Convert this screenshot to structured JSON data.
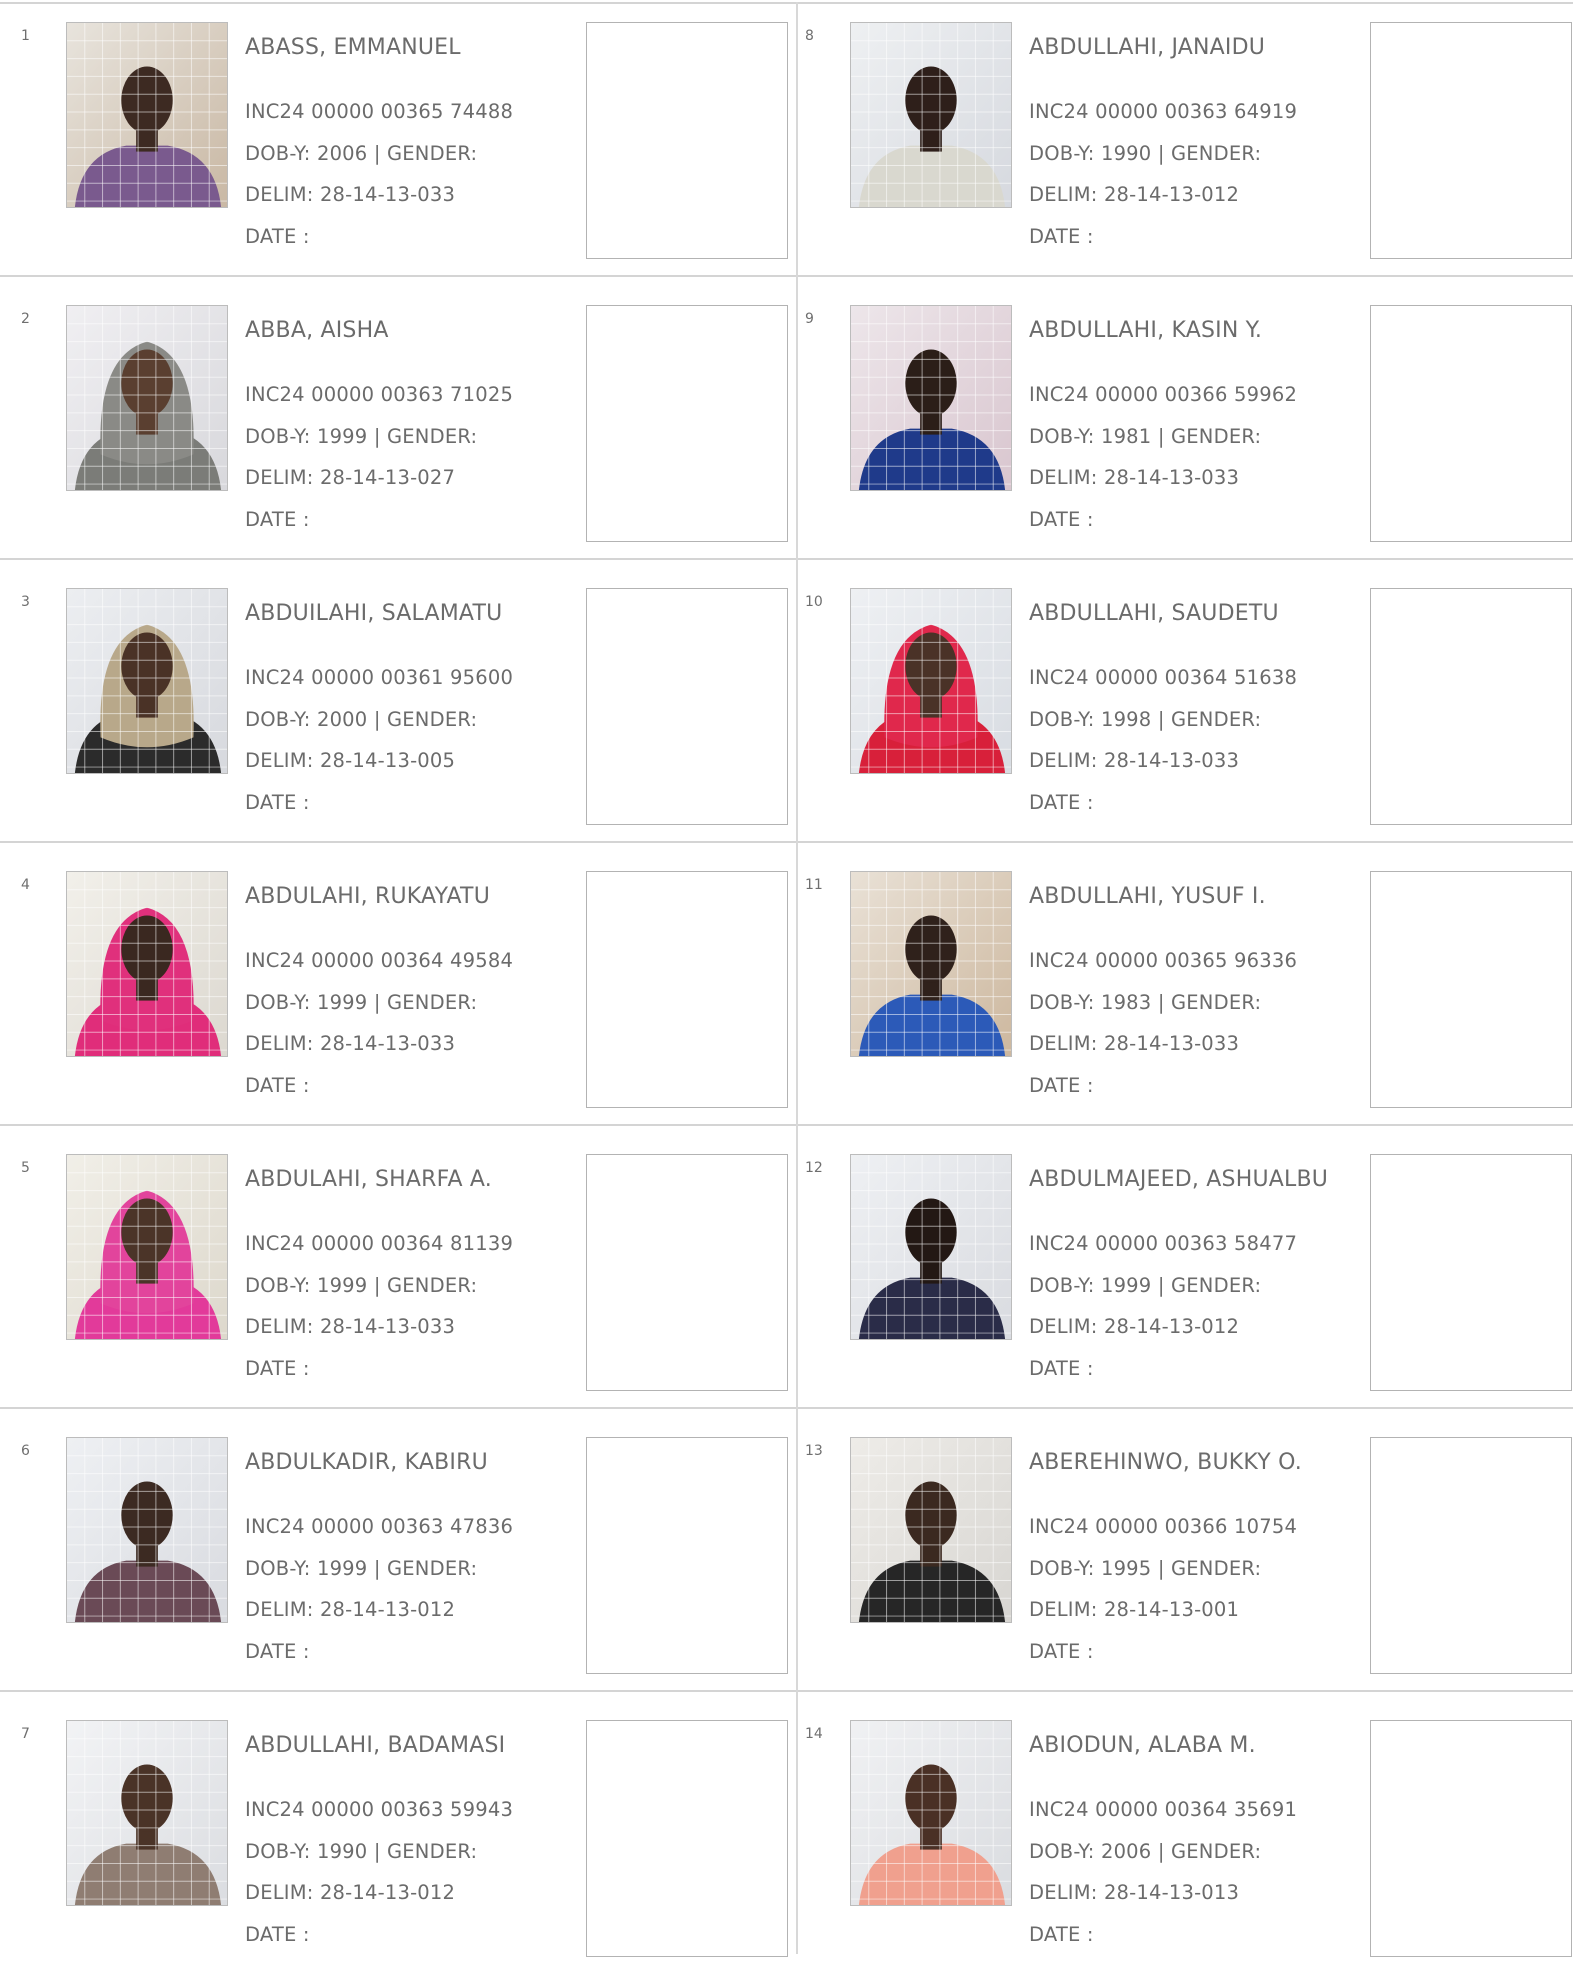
{
  "labels": {
    "dob": "DOB-Y:",
    "gender": "| GENDER:",
    "delim": "DELIM:",
    "date": "DATE  :"
  },
  "colors": {
    "rule": "#d4d4d4",
    "text": "#6b6b6b",
    "photo_grid": "#ffffff"
  },
  "records": [
    {
      "serial": "1",
      "name": "ABASS, EMMANUEL",
      "inc": "INC24 00000 00365 74488",
      "dob": "2006",
      "delim": "28-14-13-033",
      "photo": {
        "bg": "#c9b8a4",
        "bg2": "#e8e4dd",
        "skin": "#3d2a22",
        "shirt": "#7a5a8e",
        "wrap": false
      }
    },
    {
      "serial": "2",
      "name": "ABBA, AISHA",
      "inc": "INC24 00000 00363 71025",
      "dob": "1999",
      "delim": "28-14-13-027",
      "photo": {
        "bg": "#d8d8dc",
        "bg2": "#f0eff2",
        "skin": "#5a3f30",
        "shirt": "#7b7c78",
        "wrap": true,
        "wrapColor": "#8a8a86"
      }
    },
    {
      "serial": "3",
      "name": "ABDUILAHI, SALAMATU",
      "inc": "INC24 00000 00361 95600",
      "dob": "2000",
      "delim": "28-14-13-005",
      "photo": {
        "bg": "#d7d9de",
        "bg2": "#eceef1",
        "skin": "#4a3226",
        "shirt": "#2b2b2b",
        "wrap": true,
        "wrapColor": "#b8a88a"
      }
    },
    {
      "serial": "4",
      "name": "ABDULAHI, RUKAYATU",
      "inc": "INC24 00000 00364 49584",
      "dob": "1999",
      "delim": "28-14-13-033",
      "photo": {
        "bg": "#dcd8d0",
        "bg2": "#f2f0ea",
        "skin": "#3a2820",
        "shirt": "#e02d7a",
        "wrap": true,
        "wrapColor": "#e0307c"
      }
    },
    {
      "serial": "5",
      "name": "ABDULAHI, SHARFA A.",
      "inc": "INC24 00000 00364 81139",
      "dob": "1999",
      "delim": "28-14-13-033",
      "photo": {
        "bg": "#ddd8cc",
        "bg2": "#f1efe8",
        "skin": "#4b3428",
        "shirt": "#e23a9a",
        "wrap": true,
        "wrapColor": "#e2449c"
      }
    },
    {
      "serial": "6",
      "name": "ABDULKADIR, KABIRU",
      "inc": "INC24 00000 00363 47836",
      "dob": "1999",
      "delim": "28-14-13-012",
      "photo": {
        "bg": "#d9dbe0",
        "bg2": "#eef0f3",
        "skin": "#3c2a22",
        "shirt": "#6a4a56",
        "wrap": false
      }
    },
    {
      "serial": "7",
      "name": "ABDULLAHI, BADAMASI",
      "inc": "INC24 00000 00363 59943",
      "dob": "1990",
      "delim": "28-14-13-012",
      "photo": {
        "bg": "#dbdde1",
        "bg2": "#f2f3f5",
        "skin": "#4a3327",
        "shirt": "#8f7d72",
        "wrap": false
      }
    },
    {
      "serial": "8",
      "name": "ABDULLAHI, JANAIDU",
      "inc": "INC24 00000 00363 64919",
      "dob": "1990",
      "delim": "28-14-13-012",
      "photo": {
        "bg": "#d6d9df",
        "bg2": "#eef0f2",
        "skin": "#2e1f1a",
        "shirt": "#d9d8cf",
        "wrap": false
      }
    },
    {
      "serial": "9",
      "name": "ABDULLAHI, KASIN Y.",
      "inc": "INC24 00000 00366 59962",
      "dob": "1981",
      "delim": "28-14-13-033",
      "photo": {
        "bg": "#d9c6cf",
        "bg2": "#ede6ea",
        "skin": "#2b1e18",
        "shirt": "#1f3a8a",
        "wrap": false
      }
    },
    {
      "serial": "10",
      "name": "ABDULLAHI, SAUDETU",
      "inc": "INC24 00000 00364 51638",
      "dob": "1998",
      "delim": "28-14-13-033",
      "photo": {
        "bg": "#d8dce2",
        "bg2": "#eef0f3",
        "skin": "#4a3227",
        "shirt": "#d8203a",
        "wrap": true,
        "wrapColor": "#e0284c"
      }
    },
    {
      "serial": "11",
      "name": "ABDULLAHI, YUSUF I.",
      "inc": "INC24 00000 00365 96336",
      "dob": "1983",
      "delim": "28-14-13-033",
      "photo": {
        "bg": "#cdb89f",
        "bg2": "#e9e1d6",
        "skin": "#2f211b",
        "shirt": "#2c5ab8",
        "wrap": false
      }
    },
    {
      "serial": "12",
      "name": "ABDULMAJEED, ASHUALBU",
      "inc": "INC24 00000 00363 58477",
      "dob": "1999",
      "delim": "28-14-13-012",
      "photo": {
        "bg": "#d9dbe0",
        "bg2": "#eef0f3",
        "skin": "#231814",
        "shirt": "#2a2c48",
        "wrap": false
      }
    },
    {
      "serial": "13",
      "name": "ABEREHINWO, BUKKY O.",
      "inc": "INC24 00000 00366 10754",
      "dob": "1995",
      "delim": "28-14-13-001",
      "photo": {
        "bg": "#d8d6d2",
        "bg2": "#eeece8",
        "skin": "#3b2920",
        "shirt": "#262626",
        "wrap": false
      }
    },
    {
      "serial": "14",
      "name": "ABIODUN, ALABA M.",
      "inc": "INC24 00000 00364 35691",
      "dob": "2006",
      "delim": "28-14-13-013",
      "photo": {
        "bg": "#dadce0",
        "bg2": "#f0f1f3",
        "skin": "#4a3025",
        "shirt": "#f0a08e",
        "wrap": false
      }
    }
  ]
}
